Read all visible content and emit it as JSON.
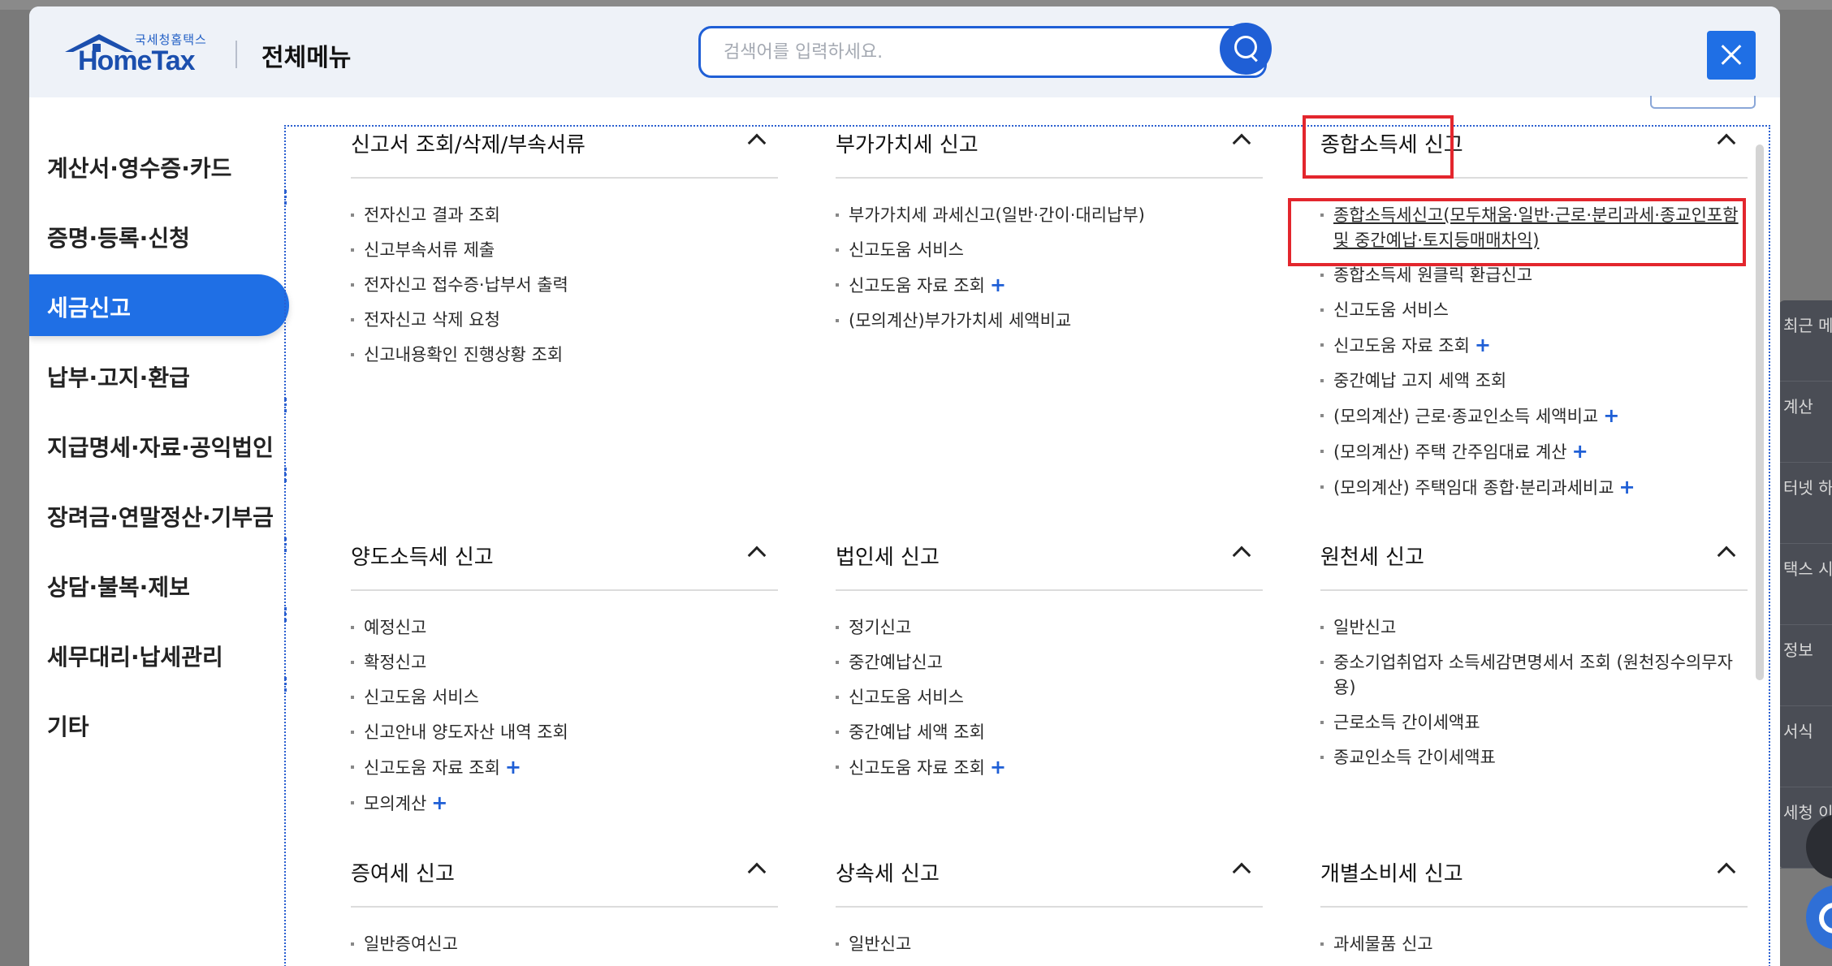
{
  "header": {
    "logo_sub": "국세청홈택스",
    "logo_main": "HomeTax",
    "title": "전체메뉴",
    "search_placeholder": "검색어를 입력하세요."
  },
  "sidebar": {
    "items": [
      {
        "label": "계산서·영수증·카드",
        "active": false
      },
      {
        "label": "증명·등록·신청",
        "active": false
      },
      {
        "label": "세금신고",
        "active": true
      },
      {
        "label": "납부·고지·환급",
        "active": false
      },
      {
        "label": "지급명세·자료·공익법인",
        "active": false
      },
      {
        "label": "장려금·연말정산·기부금",
        "active": false
      },
      {
        "label": "상담·불복·제보",
        "active": false
      },
      {
        "label": "세무대리·납세관리",
        "active": false
      },
      {
        "label": "기타",
        "active": false
      }
    ]
  },
  "sections": [
    {
      "title": "신고서 조회/삭제/부속서류",
      "items": [
        {
          "label": "전자신고 결과 조회",
          "plus": false
        },
        {
          "label": "신고부속서류 제출",
          "plus": false
        },
        {
          "label": "전자신고 접수증·납부서 출력",
          "plus": false
        },
        {
          "label": "전자신고 삭제 요청",
          "plus": false
        },
        {
          "label": "신고내용확인 진행상황 조회",
          "plus": false
        }
      ]
    },
    {
      "title": "부가가치세 신고",
      "items": [
        {
          "label": "부가가치세 과세신고(일반·간이·대리납부)",
          "plus": false
        },
        {
          "label": "신고도움 서비스",
          "plus": false
        },
        {
          "label": "신고도움 자료 조회",
          "plus": true
        },
        {
          "label": "(모의계산)부가가치세 세액비교",
          "plus": false
        }
      ]
    },
    {
      "title": "종합소득세 신고",
      "items": [
        {
          "label": "종합소득세신고(모두채움·일반·근로·분리과세·종교인포함 및 중간예납·토지등매매차익)",
          "plus": false
        },
        {
          "label": "종합소득세 원클릭 환급신고",
          "plus": false
        },
        {
          "label": "신고도움 서비스",
          "plus": false
        },
        {
          "label": "신고도움 자료 조회",
          "plus": true
        },
        {
          "label": "중간예납 고지 세액 조회",
          "plus": false
        },
        {
          "label": "(모의계산) 근로·종교인소득 세액비교",
          "plus": true
        },
        {
          "label": "(모의계산) 주택 간주임대료 계산",
          "plus": true
        },
        {
          "label": "(모의계산) 주택임대 종합·분리과세비교",
          "plus": true
        }
      ]
    },
    {
      "title": "양도소득세 신고",
      "items": [
        {
          "label": "예정신고",
          "plus": false
        },
        {
          "label": "확정신고",
          "plus": false
        },
        {
          "label": "신고도움 서비스",
          "plus": false
        },
        {
          "label": "신고안내 양도자산 내역 조회",
          "plus": false
        },
        {
          "label": "신고도움 자료 조회",
          "plus": true
        },
        {
          "label": "모의계산",
          "plus": true
        }
      ]
    },
    {
      "title": "법인세 신고",
      "items": [
        {
          "label": "정기신고",
          "plus": false
        },
        {
          "label": "중간예납신고",
          "plus": false
        },
        {
          "label": "신고도움 서비스",
          "plus": false
        },
        {
          "label": "중간예납 세액 조회",
          "plus": false
        },
        {
          "label": "신고도움 자료 조회",
          "plus": true
        }
      ]
    },
    {
      "title": "원천세 신고",
      "items": [
        {
          "label": "일반신고",
          "plus": false
        },
        {
          "label": "중소기업취업자 소득세감면명세서 조회 (원천징수의무자용)",
          "plus": false
        },
        {
          "label": "근로소득 간이세액표",
          "plus": false
        },
        {
          "label": "종교인소득 간이세액표",
          "plus": false
        }
      ]
    },
    {
      "title": "증여세 신고",
      "items": [
        {
          "label": "일반증여신고",
          "plus": false
        }
      ]
    },
    {
      "title": "상속세 신고",
      "items": [
        {
          "label": "일반신고",
          "plus": false
        }
      ]
    },
    {
      "title": "개별소비세 신고",
      "items": [
        {
          "label": "과세물품 신고",
          "plus": false
        }
      ]
    }
  ],
  "quick_menu": [
    "최근 메뉴",
    "계산",
    "터넷 하기",
    "택스 시간",
    "정보",
    "서식",
    "세청 이지"
  ],
  "colors": {
    "accent": "#1f6fe5",
    "highlight": "#e3262d"
  }
}
